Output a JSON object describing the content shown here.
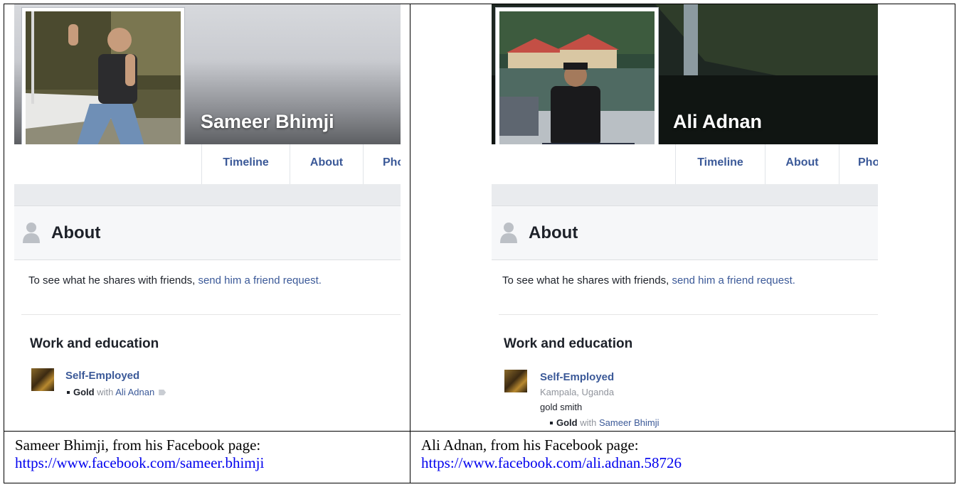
{
  "left": {
    "name": "Sameer Bhimji",
    "tabs": [
      "Timeline",
      "About",
      "Pho"
    ],
    "about_title": "About",
    "friend_text": "To see what he shares with friends,",
    "friend_link": "send him a friend request.",
    "work_title": "Work and education",
    "work_name": "Self-Employed",
    "work_item": "Gold",
    "work_with": "with",
    "work_with_name": "Ali Adnan",
    "caption": "Sameer Bhimji, from his Facebook page:",
    "url": "https://www.facebook.com/sameer.bhimji"
  },
  "right": {
    "name": "Ali Adnan",
    "tabs": [
      "Timeline",
      "About",
      "Pho"
    ],
    "about_title": "About",
    "friend_text": "To see what he shares with friends,",
    "friend_link": "send him a friend request.",
    "work_title": "Work and education",
    "work_name": "Self-Employed",
    "work_location": "Kampala, Uganda",
    "work_role": "gold smith",
    "work_item": "Gold",
    "work_with": "with",
    "work_with_name": "Sameer Bhimji",
    "caption": "Ali Adnan, from his Facebook page:",
    "url": "https://www.facebook.com/ali.adnan.58726"
  },
  "colors": {
    "facebook_link": "#3b5998",
    "hyperlink": "#0000ee"
  }
}
